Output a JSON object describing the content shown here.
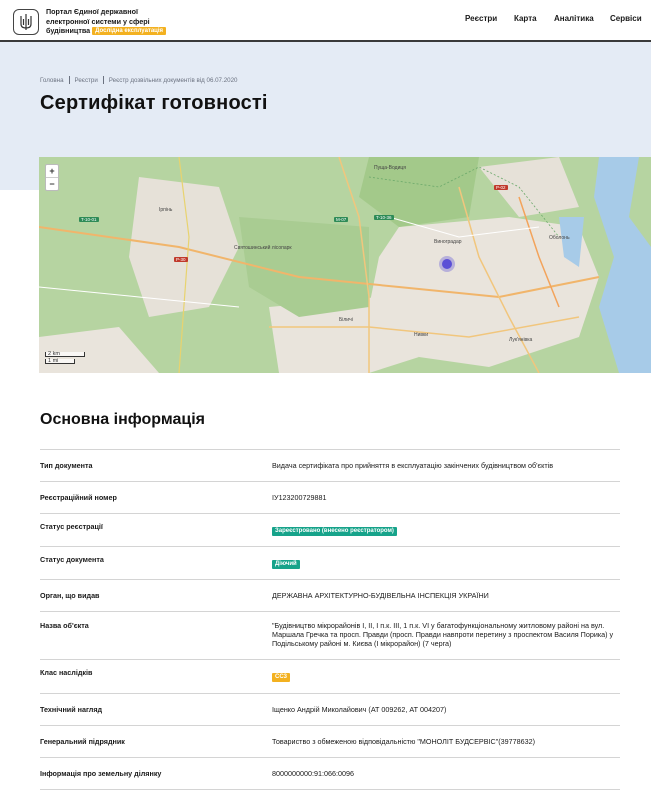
{
  "header": {
    "brand_line1": "Портал Єдиної державної",
    "brand_line2": "електронної системи у сфері",
    "brand_line3": "будівництва",
    "beta_label": "Дослідна експлуатація",
    "nav": [
      "Реєстри",
      "Карта",
      "Аналітика",
      "Сервіси"
    ]
  },
  "breadcrumb": [
    "Головна",
    "Реєстри",
    "Реєстр дозвільних документів від 06.07.2020"
  ],
  "page_title": "Сертифікат готовності",
  "map": {
    "zoom_in": "+",
    "zoom_out": "−",
    "scale_km": "2 km",
    "scale_mi": "1 mi",
    "labels": [
      "Святошинський лісопарк",
      "Виноградар",
      "Оболонь",
      "Пуща-Водиця",
      "Лук'янівка",
      "Нивки",
      "Біличі",
      "Ірпінь"
    ],
    "colors": {
      "forest": "#b6d4a1",
      "urban": "#e9e4dc",
      "water": "#a7cbe8",
      "marker": "#5b4fd6"
    }
  },
  "section_title": "Основна інформація",
  "info": {
    "doc_type_label": "Тип документа",
    "doc_type_value": "Видача сертифіката про прийняття в експлуатацію закінчених будівництвом об'єктів",
    "reg_num_label": "Реєстраційний номер",
    "reg_num_value": "ІУ123200729881",
    "reg_status_label": "Статус реєстрації",
    "reg_status_value": "Зареєстровано (внесено реєстратором)",
    "doc_status_label": "Статус документа",
    "doc_status_value": "Діючий",
    "issuer_label": "Орган, що видав",
    "issuer_value": "ДЕРЖАВНА АРХІТЕКТУРНО-БУДІВЕЛЬНА ІНСПЕКЦІЯ УКРАЇНИ",
    "object_label": "Назва об'єкта",
    "object_value": "\"Будівництво мікрорайонів І, ІІ, І п.к. ІІІ, 1 п.к. VI у багатофункціональному житловому районі на вул. Маршала Гречка та просп. Правди (просп. Правди навпроти перетину з проспектом Василя Порика) у Подільському районі м. Києва (І мікрорайон) (7 черга)",
    "class_label": "Клас наслідків",
    "class_value": "СС3",
    "tech_label": "Технічний нагляд",
    "tech_value": "Іщенко Андрій Миколайович (АТ 009262, АТ 004207)",
    "contractor_label": "Генеральний підрядник",
    "contractor_value": "Товариство з обмеженою відповідальністю \"МОНОЛІТ БУДСЕРВІС\"(39778632)",
    "land_label": "Інформація про земельну ділянку",
    "land_value": "8000000000:91:066:0096"
  }
}
